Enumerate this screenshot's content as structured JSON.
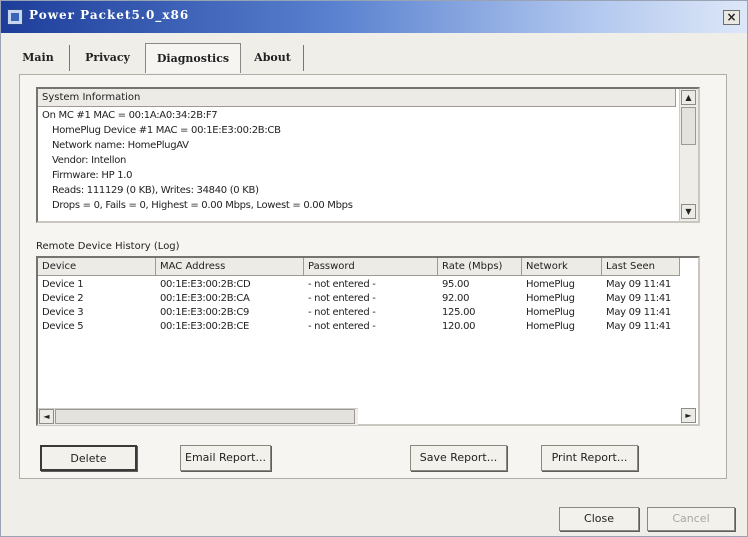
{
  "window": {
    "title": "Power Packet5.0_x86",
    "close_glyph": "×"
  },
  "tabs": [
    {
      "label": "Main",
      "selected": false
    },
    {
      "label": "Privacy",
      "selected": false
    },
    {
      "label": "Diagnostics",
      "selected": true
    },
    {
      "label": "About",
      "selected": false
    }
  ],
  "system_info": {
    "header": "System Information",
    "lines": [
      "On MC #1 MAC = 00:1A:A0:34:2B:F7",
      "HomePlug Device #1 MAC = 00:1E:E3:00:2B:CB",
      "Network name: HomePlugAV",
      "Vendor: Intellon",
      "Firmware: HP 1.0",
      "Reads: 111129 (0 KB), Writes: 34840 (0 KB)",
      "Drops = 0, Fails = 0, Highest = 0.00 Mbps, Lowest = 0.00 Mbps"
    ]
  },
  "remote_history": {
    "label": "Remote Device History (Log)",
    "columns": [
      "Device",
      "MAC Address",
      "Password",
      "Rate (Mbps)",
      "Network",
      "Last Seen"
    ],
    "rows": [
      [
        "Device 1",
        "00:1E:E3:00:2B:CD",
        "- not entered -",
        "95.00",
        "HomePlug",
        "May 09 11:41"
      ],
      [
        "Device 2",
        "00:1E:E3:00:2B:CA",
        "- not entered -",
        "92.00",
        "HomePlug",
        "May 09 11:41"
      ],
      [
        "Device 3",
        "00:1E:E3:00:2B:C9",
        "- not entered -",
        "125.00",
        "HomePlug",
        "May 09 11:41"
      ],
      [
        "Device 5",
        "00:1E:E3:00:2B:CE",
        "- not entered -",
        "120.00",
        "HomePlug",
        "May 09 11:41"
      ]
    ]
  },
  "buttons": {
    "delete": "Delete",
    "email": "Email Report...",
    "save": "Save Report...",
    "print": "Print Report..."
  },
  "footer": {
    "close": "Close",
    "cancel": "Cancel"
  }
}
